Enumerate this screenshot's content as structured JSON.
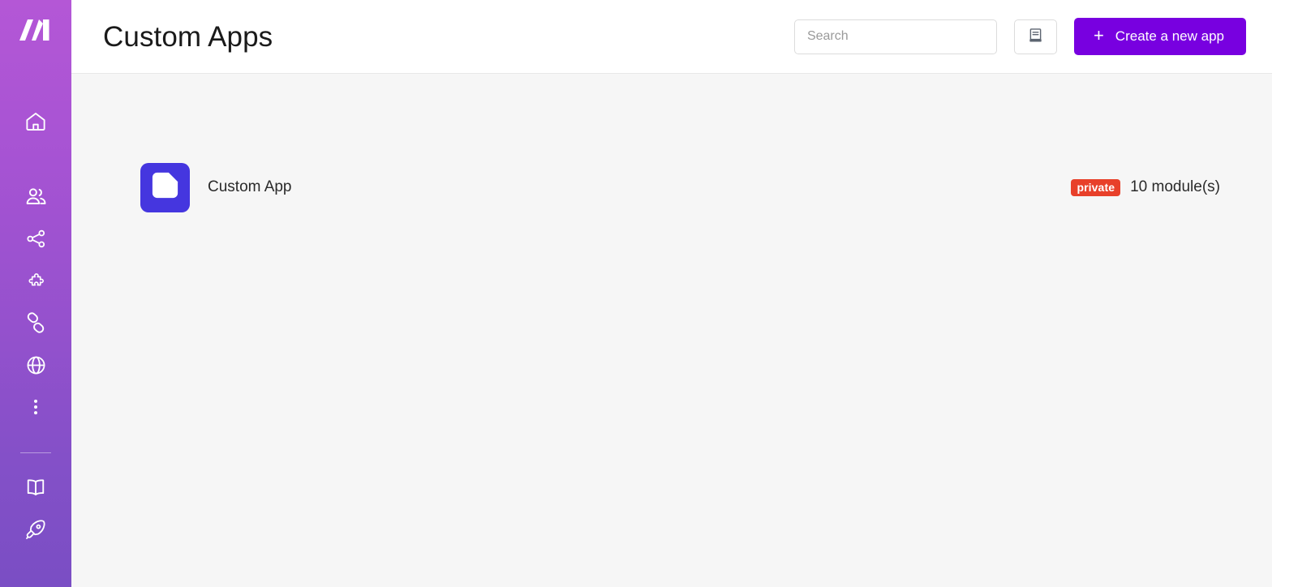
{
  "brand": {
    "logo_icon": "make-logo-icon",
    "accent_purple": "#7800e0",
    "sidebar_gradient_top": "#b457d6",
    "sidebar_gradient_bottom": "#7a4ec4"
  },
  "sidebar": {
    "items": [
      {
        "icon": "home-icon",
        "name": "sidebar-item-home"
      },
      {
        "icon": "users-icon",
        "name": "sidebar-item-team"
      },
      {
        "icon": "share-nodes-icon",
        "name": "sidebar-item-scenarios"
      },
      {
        "icon": "puzzle-piece-icon",
        "name": "sidebar-item-templates"
      },
      {
        "icon": "link-chain-icon",
        "name": "sidebar-item-connections"
      },
      {
        "icon": "globe-icon",
        "name": "sidebar-item-webhooks"
      },
      {
        "icon": "dots-vertical-icon",
        "name": "sidebar-item-more"
      }
    ],
    "bottom_items": [
      {
        "icon": "book-open-icon",
        "name": "sidebar-item-docs"
      },
      {
        "icon": "rocket-icon",
        "name": "sidebar-item-get-started"
      }
    ]
  },
  "header": {
    "title": "Custom Apps",
    "search": {
      "placeholder": "Search",
      "value": ""
    },
    "docs_button": {
      "icon": "manual-book-icon",
      "label": ""
    },
    "create_button": {
      "plus": "+",
      "label": "Create a new app"
    }
  },
  "content": {
    "apps": [
      {
        "icon": "custom-app-page-icon",
        "icon_bg": "#4536df",
        "name": "Custom App",
        "visibility": "private",
        "visibility_color": "#e8402a",
        "modules": "10 module(s)"
      }
    ]
  }
}
